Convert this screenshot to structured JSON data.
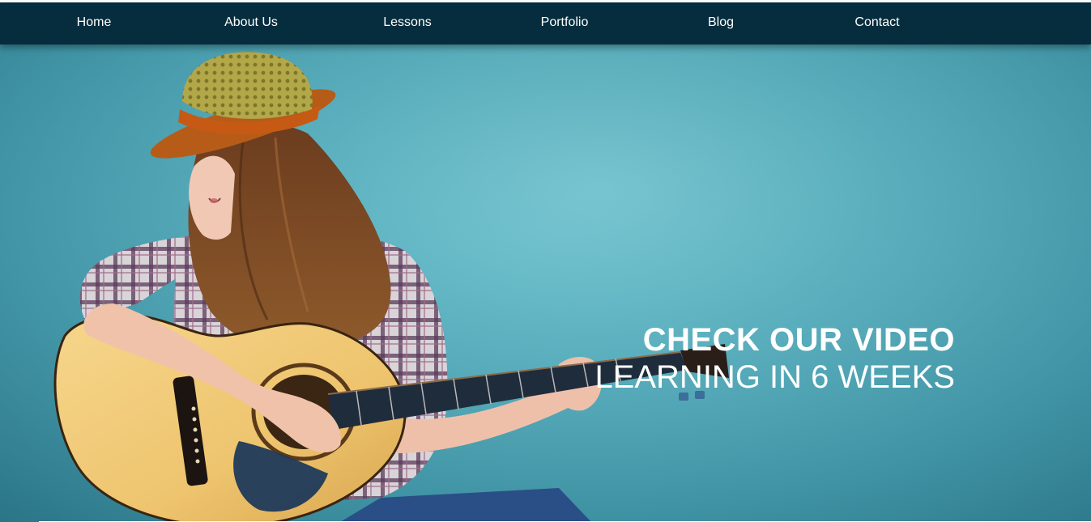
{
  "nav": {
    "items": [
      {
        "label": "Home"
      },
      {
        "label": "About Us"
      },
      {
        "label": "Lessons"
      },
      {
        "label": "Portfolio"
      },
      {
        "label": "Blog"
      },
      {
        "label": "Contact"
      }
    ]
  },
  "hero": {
    "title": "CHECK OUR VIDEO",
    "subtitle": "LEARNING IN 6 WEEKS",
    "image": "guitarist-photo"
  },
  "colors": {
    "nav_background": "#062d3e",
    "hero_background": "#53b0c0",
    "text": "#ffffff"
  }
}
